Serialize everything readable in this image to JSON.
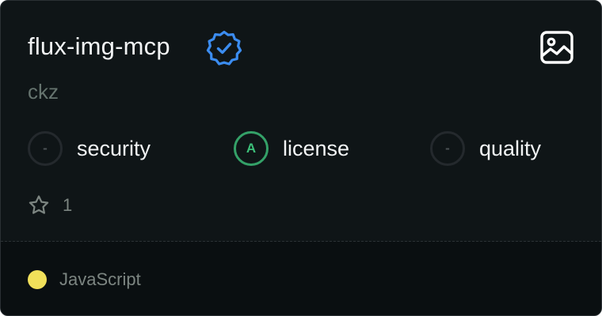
{
  "card": {
    "name": "flux-img-mcp",
    "author": "ckz",
    "verified_icon": "verified-badge-icon",
    "image_icon": "image-icon",
    "scores": [
      {
        "grade": "-",
        "label": "security"
      },
      {
        "grade": "A",
        "label": "license"
      },
      {
        "grade": "-",
        "label": "quality"
      }
    ],
    "stars": "1",
    "star_icon": "star-icon",
    "language": {
      "name": "JavaScript",
      "color": "#f1e05a"
    }
  },
  "colors": {
    "background": "#0f1517",
    "footer_background": "#0a0f11",
    "verified": "#3b8cf0",
    "grade_good": "#34a168",
    "muted_text": "#65736e"
  }
}
